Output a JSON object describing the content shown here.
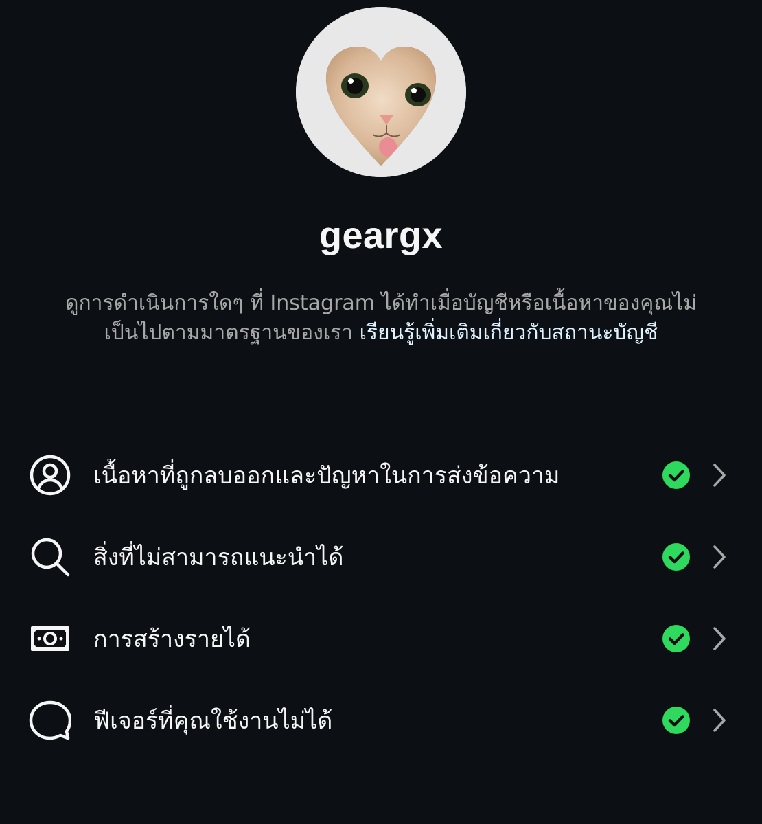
{
  "profile": {
    "username": "geargx",
    "avatar_icon": "cat-heart-avatar"
  },
  "description": {
    "text": "ดูการดำเนินการใดๆ ที่ Instagram ได้ทำเมื่อบัญชีหรือเนื้อหาของคุณไม่เป็นไปตามมาตรฐานของเรา",
    "link_text": "เรียนรู้เพิ่มเติมเกี่ยวกับสถานะบัญชี",
    "link_color": "#e0f1ff"
  },
  "status_items": [
    {
      "icon": "person-circle-icon",
      "label": "เนื้อหาที่ถูกลบออกและปัญหาในการส่งข้อความ",
      "status": "ok"
    },
    {
      "icon": "search-icon",
      "label": "สิ่งที่ไม่สามารถแนะนำได้",
      "status": "ok"
    },
    {
      "icon": "money-icon",
      "label": "การสร้างรายได้",
      "status": "ok"
    },
    {
      "icon": "chat-bubble-icon",
      "label": "ฟีเจอร์ที่คุณใช้งานไม่ได้",
      "status": "ok"
    }
  ],
  "colors": {
    "background": "#0c1014",
    "status_ok": "#2fd95d",
    "chevron": "#a8a8a8"
  }
}
